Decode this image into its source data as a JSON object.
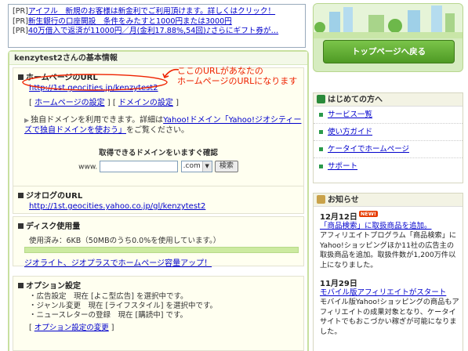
{
  "pr": {
    "tag": "[PR]",
    "lines": [
      "アイフル　新規のお客様は新金利でご利用頂けます。詳しくはクリック！",
      "新生銀行の口座開設　条件をみたすと1000円または3000円",
      "40万借入で返済が11000円／月(金利17.88%,54回)♪さらにギフト券が…"
    ]
  },
  "main": {
    "title": "kenzytest2さんの基本情報",
    "homepage_url": {
      "heading": "ホームページのURL",
      "url": "http://1st.geocities.jp/kenzytest2",
      "link_settings": "ホームページの設定",
      "link_domain": "ドメインの設定",
      "note_prefix": "独自ドメインを利用できます。詳細は",
      "note_link": "Yahoo!ドメイン「Yahoo!ジオシティーズで独自ドメインを使おう」",
      "note_suffix": "をご覧ください。",
      "search_label": "取得できるドメインをいますぐ確認",
      "www_label": "www.",
      "tld_value": ".com",
      "search_button": "検索"
    },
    "annotation": {
      "line1": "ここのURLがあなたの",
      "line2": "ホームページのURLになります"
    },
    "geolog": {
      "heading": "ジオログのURL",
      "url": "http://1st.geocities.yahoo.co.jp/gl/kenzytest2"
    },
    "disk": {
      "heading": "ディスク使用量",
      "usage_text": "使用済み：6KB（50MBのうち0.0%を使用しています。）",
      "usage_fraction": 0.0,
      "upgrade_link": "ジオライト、ジオプラスでホームページ容量アップ！"
    },
    "options": {
      "heading": "オプション設定",
      "lines": [
        "・広告設定　現在 [よこ型広告] を選択中です。",
        "・ジャンル変更　現在 [ライフスタイル] を選択中です。",
        "・ニュースレターの登録　現在 [購読中] です。"
      ],
      "change_link": "オプション設定の変更"
    }
  },
  "side": {
    "top_button": "トップページへ戻る",
    "beginners": {
      "title": "はじめての方へ",
      "items": [
        "サービス一覧",
        "使い方ガイド",
        "ケータイでホームページ",
        "サポート"
      ]
    },
    "news": {
      "title": "お知らせ",
      "new_badge": "NEW!",
      "entries": [
        {
          "date": "12月12日",
          "headline": "「商品検索」に取扱商品を追加。",
          "body": "アフィリエイトプログラム「商品検索」にYahoo!ショッピングほか11社の広告主の取扱商品を追加。取扱件数が1,200万件以上になりました。"
        },
        {
          "date": "11月29日",
          "headline": "モバイル版アフィリエイトがスタート",
          "body": "モバイル版Yahoo!ショッピングの商品もアフィリエイトの成果対象となり、ケータイサイトでもおこづかい稼ぎが可能になりました。"
        }
      ]
    }
  },
  "colors": {
    "accent_green": "#4e9a24",
    "annotation_red": "#ee2200",
    "link_blue": "#0000cc"
  }
}
